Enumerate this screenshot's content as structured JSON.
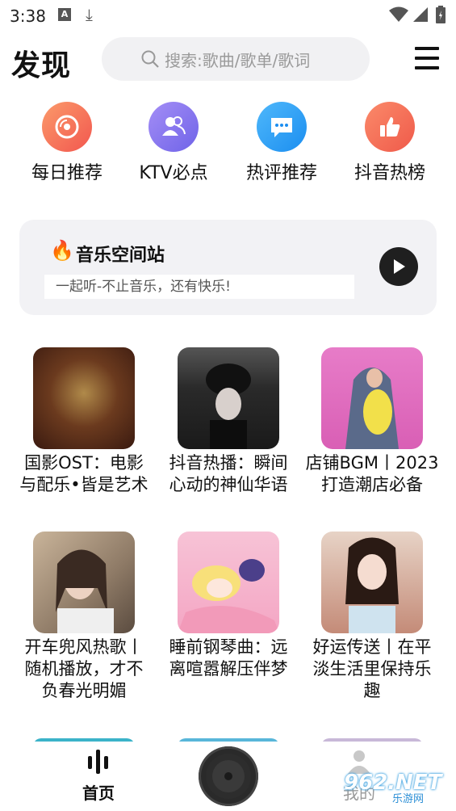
{
  "status": {
    "time": "3:38"
  },
  "header": {
    "title": "发现",
    "search_placeholder": "搜索:歌曲/歌单/歌词"
  },
  "quick_actions": [
    {
      "label": "每日推荐",
      "icon": "disc-icon",
      "color": "#f57d5f"
    },
    {
      "label": "KTV必点",
      "icon": "people-icon",
      "color": "#8b78ee"
    },
    {
      "label": "热评推荐",
      "icon": "chat-icon",
      "color": "#2ea0f5"
    },
    {
      "label": "抖音热榜",
      "icon": "thumbs-up-icon",
      "color": "#f5735a"
    }
  ],
  "station": {
    "title": "音乐空间站",
    "subtitle": "一起听-不止音乐，还有快乐!"
  },
  "playlists": [
    {
      "caption": "国影OST：电影与配乐•皆是艺术"
    },
    {
      "caption": "抖音热播：瞬间心动的神仙华语"
    },
    {
      "caption": "店铺BGM丨2023打造潮店必备"
    },
    {
      "caption": "开车兜风热歌丨随机播放，才不负春光明媚"
    },
    {
      "caption": "睡前钢琴曲：远离喧嚣解压伴梦"
    },
    {
      "caption": "好运传送丨在平淡生活里保持乐趣"
    }
  ],
  "bottom_nav": {
    "home_label": "首页",
    "me_label": "我的"
  },
  "watermark": {
    "text": "962.NET",
    "sub": "乐游网"
  }
}
